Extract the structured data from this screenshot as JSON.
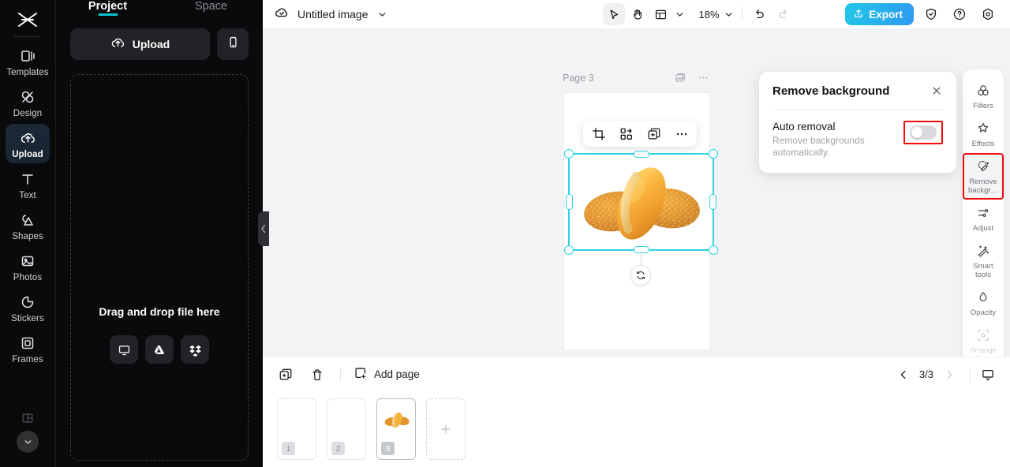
{
  "rail": {
    "logo": "capcut-logo",
    "items": [
      {
        "label": "Templates",
        "icon": "templates-icon",
        "active": false
      },
      {
        "label": "Design",
        "icon": "design-icon",
        "active": false
      },
      {
        "label": "Upload",
        "icon": "upload-cloud-icon",
        "active": true
      },
      {
        "label": "Text",
        "icon": "text-icon",
        "active": false
      },
      {
        "label": "Shapes",
        "icon": "shapes-icon",
        "active": false
      },
      {
        "label": "Photos",
        "icon": "photos-icon",
        "active": false
      },
      {
        "label": "Stickers",
        "icon": "stickers-icon",
        "active": false
      },
      {
        "label": "Frames",
        "icon": "frames-icon",
        "active": false
      }
    ],
    "more_icon": "chevron-down-icon"
  },
  "panel": {
    "tabs": [
      {
        "label": "Project",
        "active": true
      },
      {
        "label": "Space",
        "active": false
      }
    ],
    "accent_color": "#00c4cc",
    "upload_label": "Upload",
    "mobile_upload_icon": "phone-icon",
    "dropzone_text": "Drag and drop file here",
    "dropzone_sources": [
      {
        "name": "computer-icon"
      },
      {
        "name": "google-drive-icon"
      },
      {
        "name": "dropbox-icon"
      }
    ],
    "collapse_icon": "chevron-left-icon"
  },
  "topbar": {
    "cloud_icon": "cloud-saved-icon",
    "doc_title": "Untitled image",
    "title_chevron": "chevron-down-icon",
    "tools": [
      {
        "name": "select-tool",
        "icon": "cursor-icon",
        "selected": true
      },
      {
        "name": "hand-tool",
        "icon": "hand-icon",
        "selected": false
      },
      {
        "name": "layout-tool",
        "icon": "layout-icon",
        "selected": false
      }
    ],
    "zoom_value": "18%",
    "undo_icon": "undo-icon",
    "redo_icon": "redo-icon",
    "export_label": "Export",
    "export_icon": "export-upload-icon",
    "export_color": "#29b8ec",
    "shield_icon": "shield-check-icon",
    "help_icon": "help-circle-icon",
    "settings_icon": "settings-gear-icon"
  },
  "canvas": {
    "page_label": "Page 3",
    "page_tool_icons": [
      {
        "name": "page-background-icon"
      },
      {
        "name": "page-more-icon"
      }
    ],
    "selection": {
      "object": "bread-rolls-image",
      "float_tools": [
        {
          "name": "crop-icon"
        },
        {
          "name": "replace-icon"
        },
        {
          "name": "duplicate-icon"
        },
        {
          "name": "more-options-icon"
        }
      ],
      "rotate_icon": "rotate-icon",
      "handle_color": "#2ed3e3"
    }
  },
  "remove_bg_panel": {
    "title": "Remove background",
    "close_icon": "close-icon",
    "option_title": "Auto removal",
    "option_sub": "Remove backgrounds automatically.",
    "toggle_on": false,
    "highlight_color": "#f50b0b"
  },
  "dock": {
    "items": [
      {
        "label": "Filters",
        "icon": "filters-icon",
        "state": "normal"
      },
      {
        "label": "Effects",
        "icon": "effects-icon",
        "state": "normal"
      },
      {
        "label": "Remove backgr…",
        "icon": "remove-bg-icon",
        "state": "highlighted"
      },
      {
        "label": "Adjust",
        "icon": "adjust-icon",
        "state": "normal"
      },
      {
        "label": "Smart tools",
        "icon": "smart-tools-icon",
        "state": "normal"
      },
      {
        "label": "Opacity",
        "icon": "opacity-icon",
        "state": "normal"
      },
      {
        "label": "Arrange",
        "icon": "arrange-icon",
        "state": "disabled"
      }
    ]
  },
  "bottombar": {
    "duplicate_page_icon": "duplicate-page-icon",
    "delete_page_icon": "trash-icon",
    "add_page_label": "Add page",
    "add_page_icon": "add-page-icon",
    "prev_icon": "chevron-left-icon",
    "next_icon": "chevron-right-icon",
    "page_counter": "3/3",
    "present_icon": "present-icon"
  },
  "thumbnails": {
    "items": [
      {
        "num": "1",
        "selected": false,
        "has_image": false
      },
      {
        "num": "2",
        "selected": false,
        "has_image": false
      },
      {
        "num": "3",
        "selected": true,
        "has_image": true
      }
    ],
    "add_label": "+"
  }
}
